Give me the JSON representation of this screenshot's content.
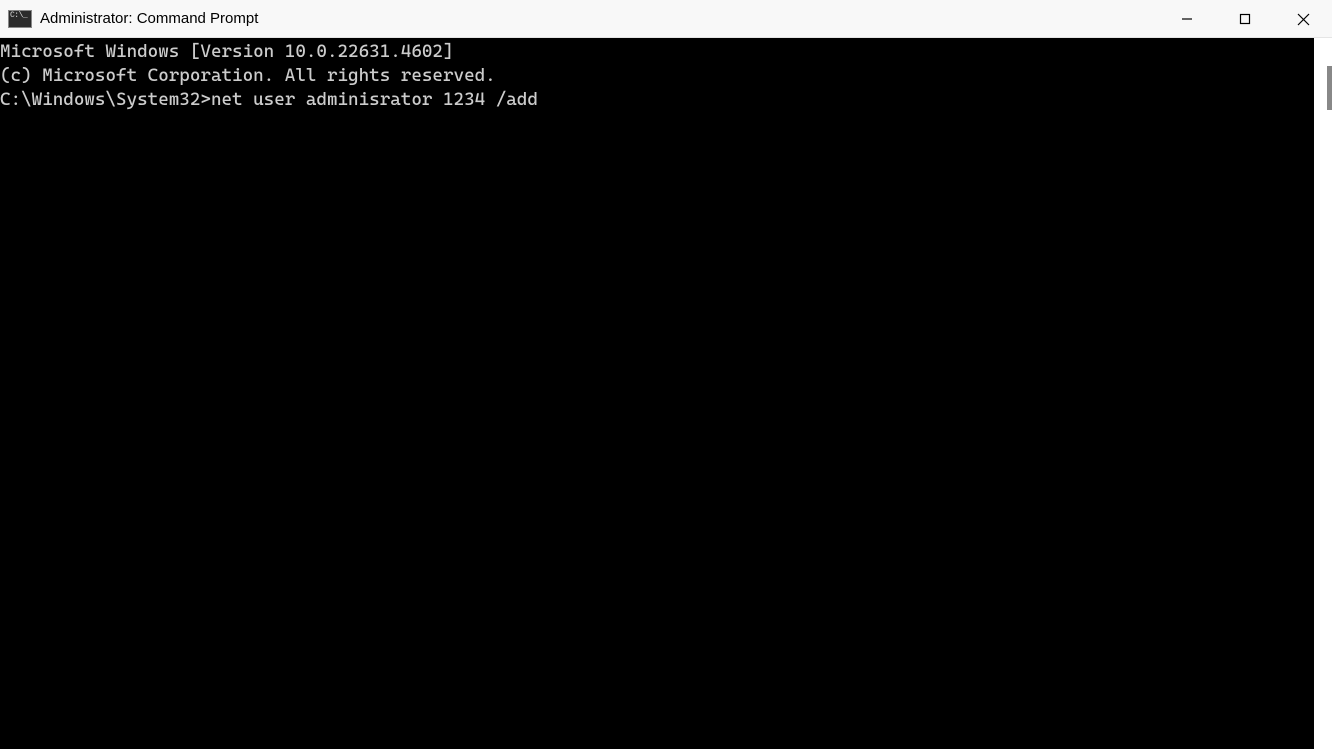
{
  "window": {
    "title": "Administrator: Command Prompt"
  },
  "terminal": {
    "line1": "Microsoft Windows [Version 10.0.22631.4602]",
    "line2": "(c) Microsoft Corporation. All rights reserved.",
    "prompt": "C:\\Windows\\System32>",
    "command": "net user adminisrator 1234 /add"
  }
}
